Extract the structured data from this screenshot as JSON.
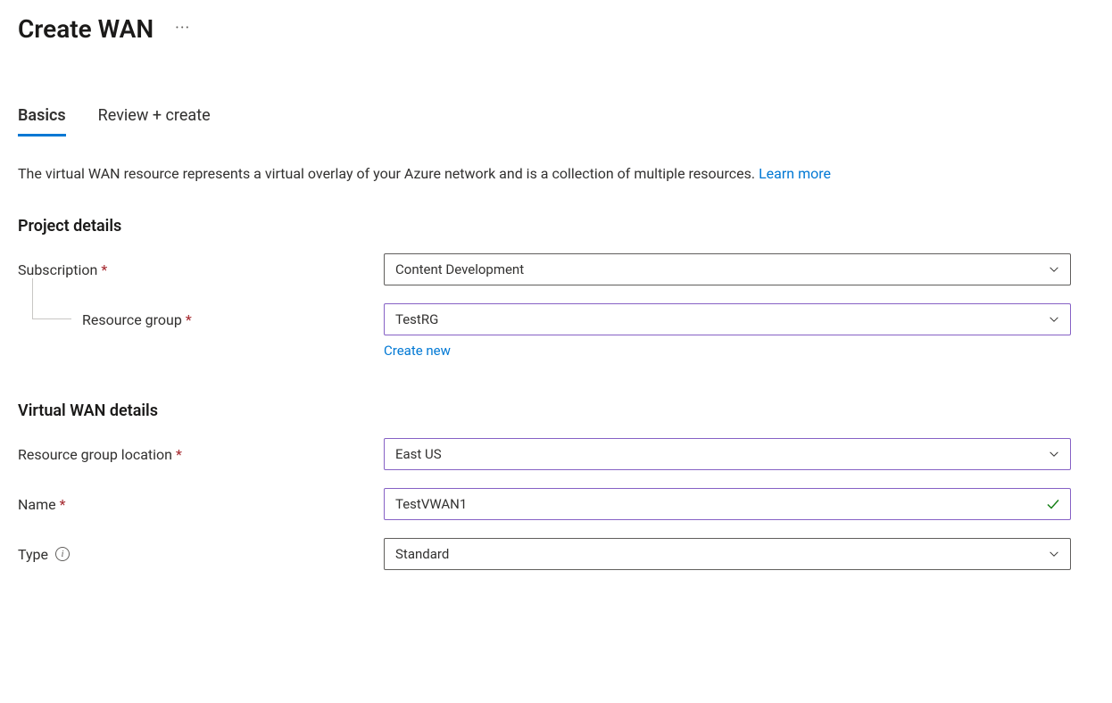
{
  "header": {
    "title": "Create WAN"
  },
  "tabs": {
    "basics": "Basics",
    "review": "Review + create"
  },
  "description": {
    "text": "The virtual WAN resource represents a virtual overlay of your Azure network and is a collection of multiple resources. ",
    "learn_more": "Learn more"
  },
  "sections": {
    "project_details": {
      "heading": "Project details",
      "subscription": {
        "label": "Subscription",
        "value": "Content Development"
      },
      "resource_group": {
        "label": "Resource group",
        "value": "TestRG",
        "create_new": "Create new"
      }
    },
    "vwan_details": {
      "heading": "Virtual WAN details",
      "location": {
        "label": "Resource group location",
        "value": "East US"
      },
      "name": {
        "label": "Name",
        "value": "TestVWAN1"
      },
      "type": {
        "label": "Type",
        "value": "Standard"
      }
    }
  }
}
